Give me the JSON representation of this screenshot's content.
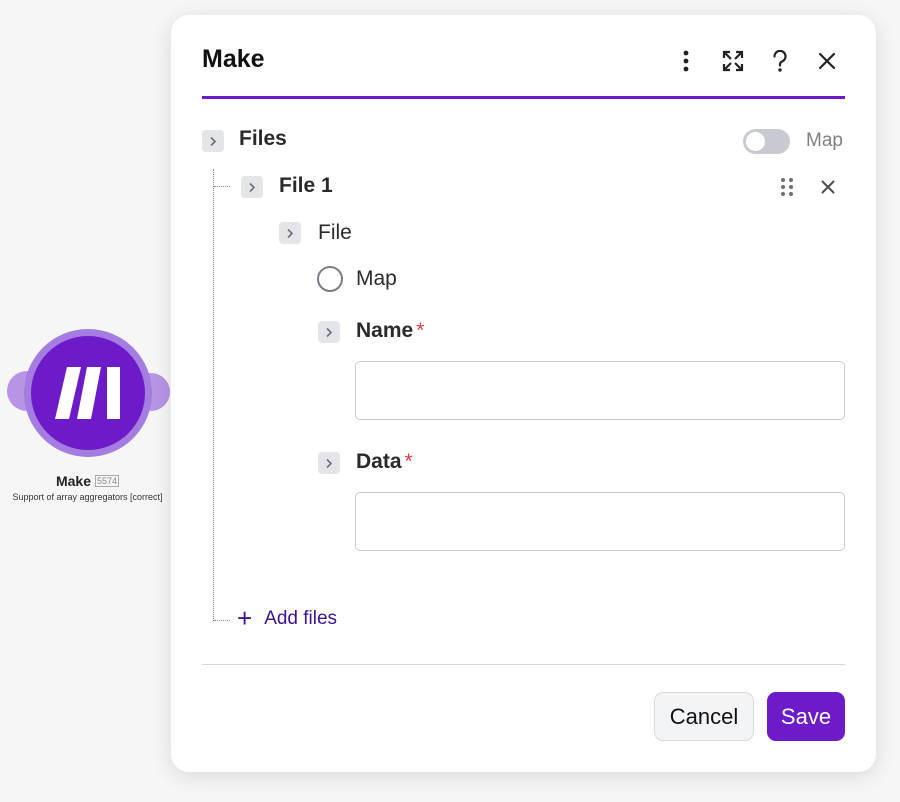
{
  "colors": {
    "brand": "#6d1ac9",
    "brand_light": "#a57ce0",
    "required": "#d63d4a",
    "link": "#3b1393"
  },
  "node": {
    "title": "Make",
    "id": "5574",
    "subtitle": "Support of array aggregators [correct]",
    "icon": "make-logo-icon"
  },
  "dialog": {
    "title": "Make",
    "actions": [
      "more-vertical-icon",
      "expand-icon",
      "help-icon",
      "close-icon"
    ]
  },
  "files": {
    "label": "Files",
    "map_toggle_label": "Map",
    "map_toggle_on": false
  },
  "file_item": {
    "label": "File 1",
    "actions": [
      "drag-handle-icon",
      "remove-icon"
    ]
  },
  "file_field": {
    "label": "File",
    "map_radio_label": "Map"
  },
  "name_field": {
    "label": "Name",
    "required_mark": "*",
    "value": ""
  },
  "data_field": {
    "label": "Data",
    "required_mark": "*",
    "value": ""
  },
  "add_files_label": "Add files",
  "footer": {
    "cancel_label": "Cancel",
    "save_label": "Save"
  }
}
